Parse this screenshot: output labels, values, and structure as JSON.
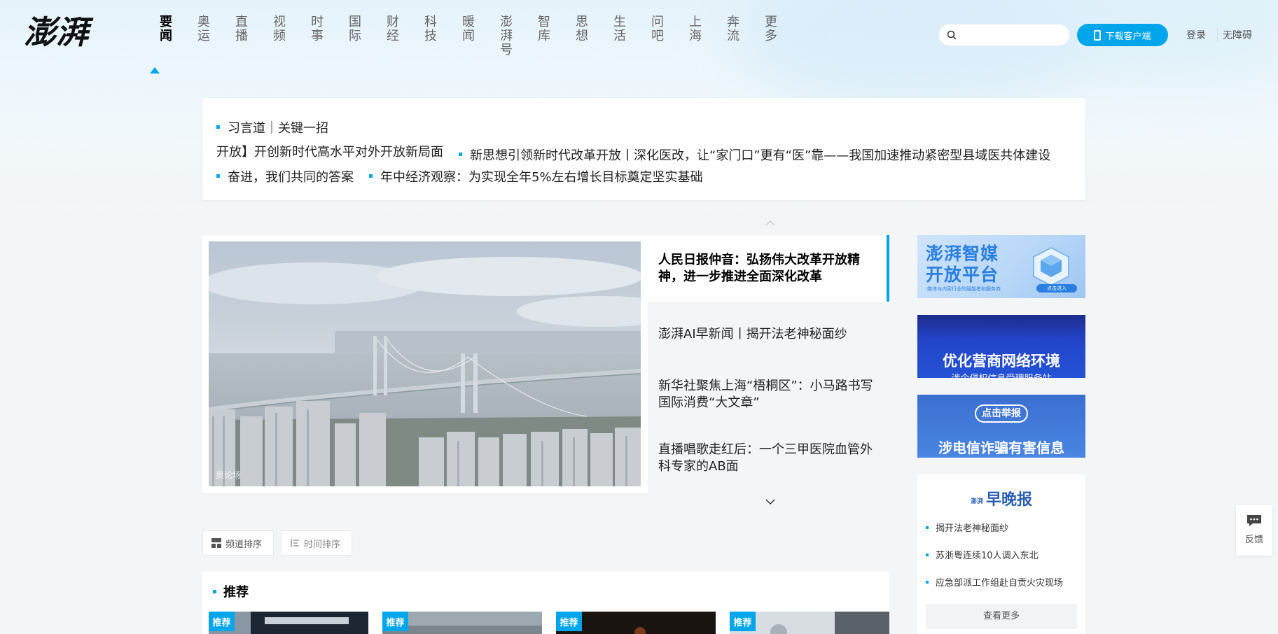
{
  "header": {
    "logo_text": "澎湃",
    "nav": [
      {
        "label": "要闻",
        "active": true
      },
      {
        "label": "奥运"
      },
      {
        "label": "直播"
      },
      {
        "label": "视频"
      },
      {
        "label": "时事"
      },
      {
        "label": "国际"
      },
      {
        "label": "财经"
      },
      {
        "label": "科技"
      },
      {
        "label": "暖闻"
      },
      {
        "label": "澎湃号"
      },
      {
        "label": "智库"
      },
      {
        "label": "思想"
      },
      {
        "label": "生活"
      },
      {
        "label": "问吧"
      },
      {
        "label": "上海"
      },
      {
        "label": "奔流"
      },
      {
        "label": "更多"
      }
    ],
    "search_placeholder": "",
    "download_label": "下载客户端",
    "login_label": "登录",
    "accessibility_label": "无障碍"
  },
  "ticker": {
    "row1": [
      "习言道｜关键一招"
    ],
    "row2": [
      "开放】开创新时代高水平对外开放新局面",
      "新思想引领新时代改革开放丨深化医改，让“家门口”更有“医”靠——我国加速推动紧密型县域医共体建设"
    ],
    "row3": [
      "奋进，我们共同的答案",
      "年中经济观察：为实现全年5%左右增长目标奠定坚实基础"
    ]
  },
  "feature": {
    "image_caption": "奥论场",
    "active_title": "人民日报仲音：弘扬伟大改革开放精神，进一步推进全面深化改革",
    "items": [
      "澎湃AI早新闻丨揭开法老神秘面纱",
      "新华社聚焦上海“梧桐区”：小马路书写国际消费“大文章”",
      "直播唱歌走红后：一个三甲医院血管外科专家的AB面"
    ]
  },
  "sort": {
    "channel_label": "频道排序",
    "time_label": "时间排序"
  },
  "recommend": {
    "title": "推荐",
    "tag": "推荐"
  },
  "ads": {
    "ad1_title": "澎湃智媒\n开放平台",
    "ad1_sub": "媒体与内容行业的赋能者和服务商",
    "ad1_btn": "点击进入",
    "ad2_title": "优化营商网络环境",
    "ad2_sub": "涉企侵权信息受理服务站",
    "ad3_pill": "点击举报",
    "ad3_title": "涉电信诈骗有害信息"
  },
  "evening": {
    "brand_small": "澎湃",
    "brand": "早晚报",
    "items": [
      "揭开法老神秘面纱",
      "苏浙粤连续10人调入东北",
      "应急部派工作组赴自贡火灾现场"
    ],
    "more_label": "查看更多"
  },
  "feedback_label": "反馈",
  "colors": {
    "accent": "#00a5eb",
    "brand_blue": "#2b5fb4"
  }
}
